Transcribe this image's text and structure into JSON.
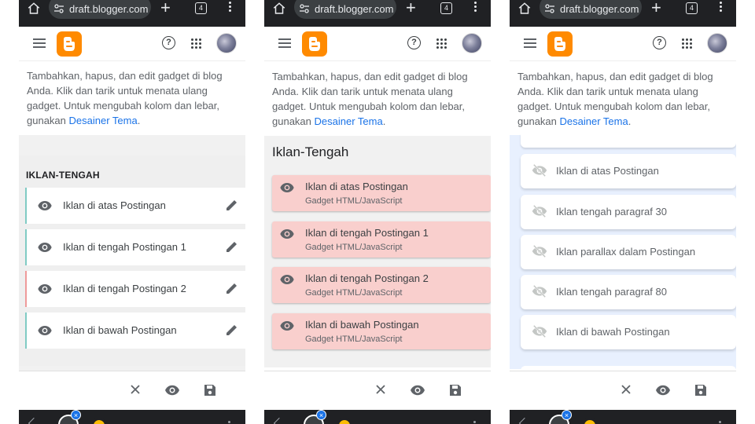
{
  "browser": {
    "url": "draft.blogger.com",
    "tab_count": "4"
  },
  "description": {
    "text": "Tambahkan, hapus, dan edit gadget di blog Anda. Klik dan tarik untuk menata ulang gadget. Untuk mengubah kolom dan lebar, gunakan ",
    "link": "Desainer Tema",
    "end": "."
  },
  "panel1": {
    "section_title": "IKLAN-TENGAH",
    "items": [
      {
        "label": "Iklan di atas Postingan"
      },
      {
        "label": "Iklan di tengah Postingan 1"
      },
      {
        "label": "Iklan di tengah Postingan 2"
      },
      {
        "label": "Iklan di bawah Postingan"
      }
    ]
  },
  "panel2": {
    "section_title": "Iklan-Tengah",
    "items": [
      {
        "label": "Iklan di atas Postingan",
        "sub": "Gadget HTML/JavaScript"
      },
      {
        "label": "Iklan di tengah Postingan 1",
        "sub": "Gadget HTML/JavaScript"
      },
      {
        "label": "Iklan di tengah Postingan 2",
        "sub": "Gadget HTML/JavaScript"
      },
      {
        "label": "Iklan di bawah Postingan",
        "sub": "Gadget HTML/JavaScript"
      }
    ]
  },
  "panel3": {
    "items": [
      {
        "label": "Iklan di atas Postingan"
      },
      {
        "label": "Iklan tengah paragraf 30"
      },
      {
        "label": "Iklan parallax dalam Postingan"
      },
      {
        "label": "Iklan tengah paragraf 80"
      },
      {
        "label": "Iklan di bawah Postingan"
      }
    ]
  },
  "system": {
    "close_badge": "×"
  },
  "colors": {
    "blogger_orange": "#ff8a00",
    "link_blue": "#1a73e8",
    "item_pink": "#f9cfcd",
    "drop_zone_blue": "#e8f0fe"
  },
  "icons": [
    "home-icon",
    "site-settings-icon",
    "new-tab-icon",
    "tab-switcher-icon",
    "more-menu-icon",
    "hamburger-menu-icon",
    "blogger-logo-icon",
    "help-icon",
    "apps-grid-icon",
    "eye-icon",
    "eye-off-icon",
    "pencil-edit-icon",
    "close-icon",
    "save-icon"
  ]
}
